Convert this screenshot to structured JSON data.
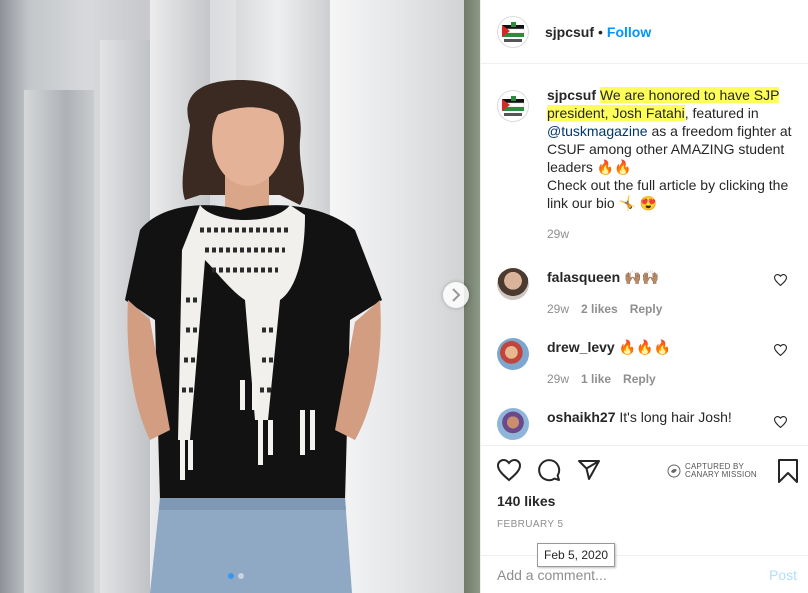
{
  "post": {
    "username": "sjpcsuf",
    "follow_label": "Follow",
    "dot": "•"
  },
  "caption": {
    "username": "sjpcsuf",
    "highlight_1": "We are honored to have SJP",
    "highlight_2": "president, Josh Fatahi",
    "text_1": ", featured in",
    "mention": "@tuskmagazine",
    "text_2": " as a freedom fighter at CSUF among other AMAZING student leaders 🔥🔥",
    "text_3": "Check out the full article by clicking the link our bio 🤸 😍",
    "time": "29w"
  },
  "comments": [
    {
      "username": "falasqueen",
      "text": "🙌🏽🙌🏽",
      "time": "29w",
      "likes": "2 likes",
      "reply": "Reply"
    },
    {
      "username": "drew_levy",
      "text": "🔥🔥🔥",
      "time": "29w",
      "likes": "1 like",
      "reply": "Reply"
    },
    {
      "username": "oshaikh27",
      "text": "It's long hair Josh!"
    }
  ],
  "actions": {
    "likes": "140 likes",
    "date": "FEBRUARY 5",
    "tooltip": "Feb 5, 2020",
    "canary_line1": "CAPTURED BY",
    "canary_line2": "CANARY MISSION",
    "comment_placeholder": "Add a comment...",
    "post_label": "Post"
  },
  "colors": {
    "link_blue": "#0095f6",
    "highlight": "#ffff5a",
    "muted": "#8e8e8e",
    "carousel_active_dot": "#3897f0"
  },
  "icons": [
    "heart-icon",
    "comment-icon",
    "share-icon",
    "bookmark-icon",
    "chevron-right-icon"
  ]
}
